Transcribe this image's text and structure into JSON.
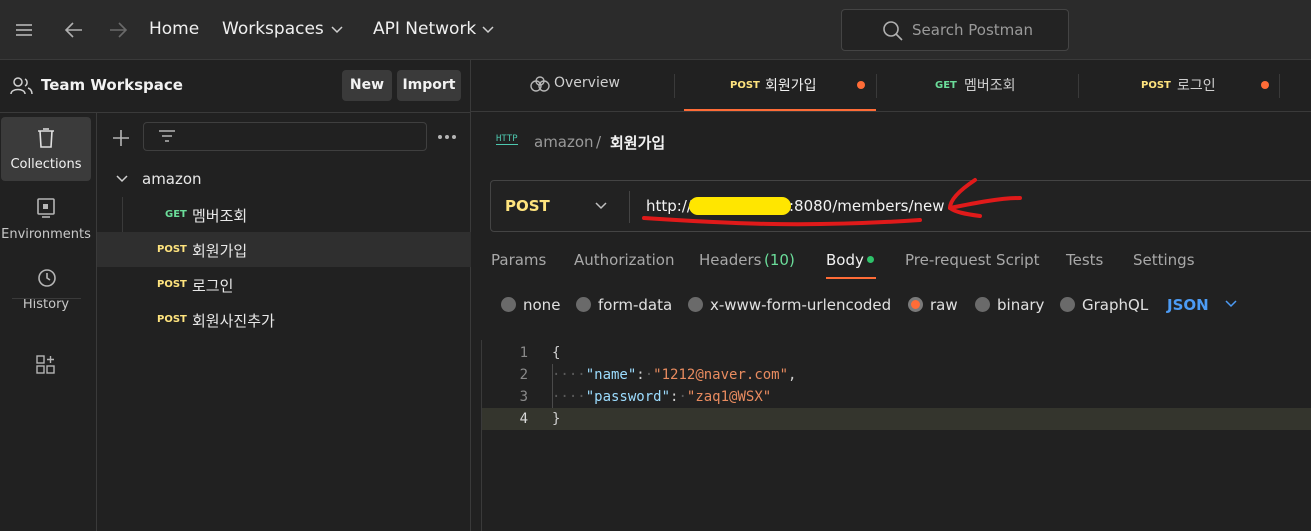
{
  "topbar": {
    "home": "Home",
    "workspaces": "Workspaces",
    "api_network": "API Network",
    "search_placeholder": "Search Postman"
  },
  "workspace": {
    "title": "Team Workspace",
    "new_label": "New",
    "import_label": "Import"
  },
  "leftnav": {
    "items": [
      {
        "label": "Collections"
      },
      {
        "label": "Environments"
      },
      {
        "label": "History"
      }
    ]
  },
  "tree": {
    "collection": "amazon",
    "requests": [
      {
        "method": "GET",
        "name": "멤버조회"
      },
      {
        "method": "POST",
        "name": "회원가입"
      },
      {
        "method": "POST",
        "name": "로그인"
      },
      {
        "method": "POST",
        "name": "회원사진추가"
      }
    ]
  },
  "tabs": [
    {
      "method": "",
      "label": "Overview"
    },
    {
      "method": "POST",
      "label": "회원가입"
    },
    {
      "method": "GET",
      "label": "멤버조회"
    },
    {
      "method": "POST",
      "label": "로그인"
    }
  ],
  "breadcrumb": {
    "icon_text": "HTTP",
    "collection": "amazon",
    "separator": "/",
    "request": "회원가입"
  },
  "request": {
    "method": "POST",
    "url_prefix": "http://",
    "url_suffix": ":8080/members/new"
  },
  "subtabs": {
    "params": "Params",
    "authorization": "Authorization",
    "headers": "Headers",
    "headers_count": "(10)",
    "body": "Body",
    "prerequest": "Pre-request Script",
    "tests": "Tests",
    "settings": "Settings"
  },
  "body_types": {
    "none": "none",
    "form_data": "form-data",
    "urlencoded": "x-www-form-urlencoded",
    "raw": "raw",
    "binary": "binary",
    "graphql": "GraphQL",
    "format": "JSON"
  },
  "editor": {
    "line_numbers": [
      "1",
      "2",
      "3",
      "4"
    ],
    "open_brace": "{",
    "close_brace": "}",
    "indent": "····",
    "key1": "\"name\"",
    "val1": "\"1212@naver.com\"",
    "key2": "\"password\"",
    "val2": "\"zaq1@WSX\"",
    "colon": ":",
    "comma": ",",
    "space": "·"
  },
  "colors": {
    "accent": "#ff6c37",
    "post": "#ffe47e",
    "get": "#6bdd9a",
    "link": "#4c9bf4"
  }
}
